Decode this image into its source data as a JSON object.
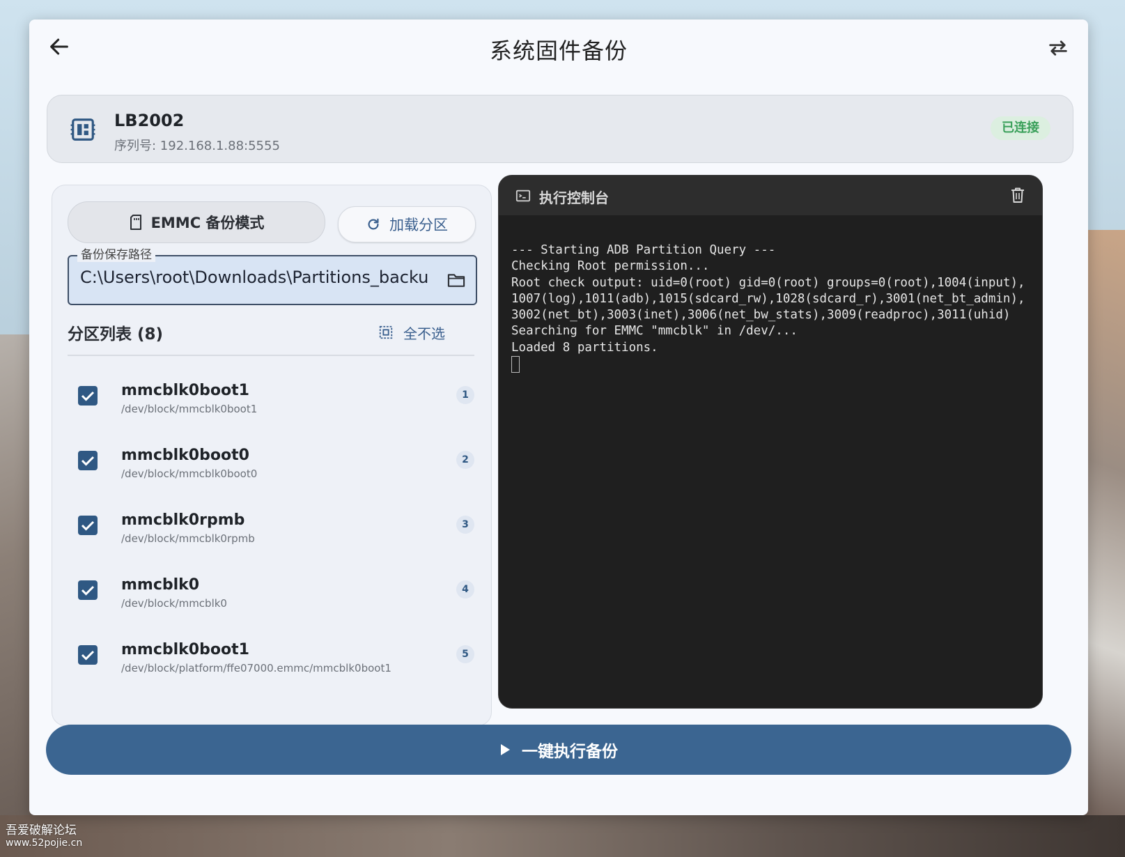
{
  "window": {
    "title": "系统固件备份"
  },
  "device": {
    "name": "LB2002",
    "serial": "序列号: 192.168.1.88:5555",
    "status": "已连接"
  },
  "controls": {
    "mode_label": "EMMC 备份模式",
    "load_label": "加载分区",
    "path_label": "备份保存路径",
    "path_value": "C:\\Users\\root\\Downloads\\Partitions_backup"
  },
  "partitions": {
    "title": "分区列表 (8)",
    "deselect_label": "全不选",
    "items": [
      {
        "name": "mmcblk0boot1",
        "path": "/dev/block/mmcblk0boot1",
        "index": "1",
        "checked": true
      },
      {
        "name": "mmcblk0boot0",
        "path": "/dev/block/mmcblk0boot0",
        "index": "2",
        "checked": true
      },
      {
        "name": "mmcblk0rpmb",
        "path": "/dev/block/mmcblk0rpmb",
        "index": "3",
        "checked": true
      },
      {
        "name": "mmcblk0",
        "path": "/dev/block/mmcblk0",
        "index": "4",
        "checked": true
      },
      {
        "name": "mmcblk0boot1",
        "path": "/dev/block/platform/ffe07000.emmc/mmcblk0boot1",
        "index": "5",
        "checked": true
      }
    ]
  },
  "console": {
    "title": "执行控制台",
    "lines": [
      "--- Starting ADB Partition Query ---",
      "Checking Root permission...",
      "Root check output: uid=0(root) gid=0(root) groups=0(root),1004(input),1007(log),1011(adb),1015(sdcard_rw),1028(sdcard_r),3001(net_bt_admin),3002(net_bt),3003(inet),3006(net_bw_stats),3009(readproc),3011(uhid)",
      "Searching for EMMC \"mmcblk\" in /dev/...",
      "Loaded 8 partitions."
    ]
  },
  "action": {
    "run_label": "一键执行备份"
  },
  "watermark": {
    "name": "吾爱破解论坛",
    "url": "www.52pojie.cn"
  },
  "colors": {
    "accent": "#3b6591",
    "checkbox": "#2f5883",
    "status_green": "#3aa05a",
    "console_bg": "#1f1f1f"
  }
}
